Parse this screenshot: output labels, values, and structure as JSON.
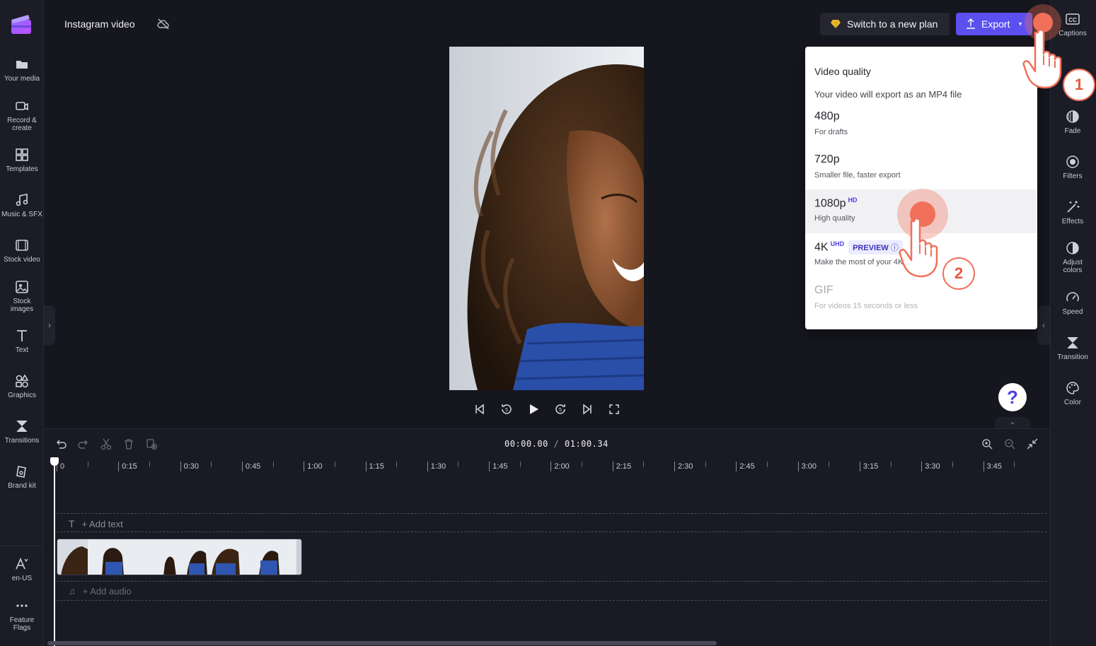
{
  "project": {
    "title": "Instagram video"
  },
  "left_sidebar": {
    "items": [
      {
        "label": "Your media",
        "icon": "folder-icon"
      },
      {
        "label": "Record & create",
        "icon": "camera-icon"
      },
      {
        "label": "Templates",
        "icon": "templates-icon"
      },
      {
        "label": "Music & SFX",
        "icon": "music-icon"
      },
      {
        "label": "Stock video",
        "icon": "film-icon"
      },
      {
        "label": "Stock images",
        "icon": "image-icon"
      },
      {
        "label": "Text",
        "icon": "text-icon"
      },
      {
        "label": "Graphics",
        "icon": "shapes-icon"
      },
      {
        "label": "Transitions",
        "icon": "transition-icon"
      },
      {
        "label": "Brand kit",
        "icon": "brand-kit-icon"
      }
    ],
    "bottom": [
      {
        "label": "en-US",
        "icon": "language-icon"
      },
      {
        "label": "Feature Flags",
        "icon": "more-icon"
      }
    ]
  },
  "header": {
    "switch_plan_label": "Switch to a new plan",
    "export_label": "Export"
  },
  "right_sidebar": {
    "items": [
      {
        "label": "Captions",
        "icon": "captions-icon"
      },
      {
        "label": "Fade",
        "icon": "fade-icon"
      },
      {
        "label": "Filters",
        "icon": "filters-icon"
      },
      {
        "label": "Effects",
        "icon": "effects-icon"
      },
      {
        "label": "Adjust colors",
        "icon": "adjust-icon"
      },
      {
        "label": "Speed",
        "icon": "speed-icon"
      },
      {
        "label": "Transition",
        "icon": "transition-icon"
      },
      {
        "label": "Color",
        "icon": "palette-icon"
      }
    ]
  },
  "export_menu": {
    "title": "Video quality",
    "subtitle": "Your video will export as an MP4 file",
    "options": [
      {
        "label": "480p",
        "badge": "",
        "tag": "",
        "desc": "For drafts"
      },
      {
        "label": "720p",
        "badge": "",
        "tag": "",
        "desc": "Smaller file, faster export"
      },
      {
        "label": "1080p",
        "badge": "HD",
        "tag": "",
        "desc": "High quality"
      },
      {
        "label": "4K",
        "badge": "UHD",
        "tag": "PREVIEW",
        "desc": "Make the most of your 4K"
      },
      {
        "label": "GIF",
        "badge": "",
        "tag": "",
        "desc": "For videos 15 seconds or less"
      }
    ]
  },
  "timeline": {
    "current_time": "00:00.00",
    "separator": "/",
    "total_time": "01:00.34",
    "ruler": [
      "0",
      "0:15",
      "0:30",
      "0:45",
      "1:00",
      "1:15",
      "1:30",
      "1:45",
      "2:00",
      "2:15",
      "2:30",
      "2:45",
      "3:00",
      "3:15",
      "3:30",
      "3:45"
    ],
    "add_text": "+ Add text",
    "add_audio": "+ Add audio"
  },
  "help": {
    "label": "?"
  },
  "steps": {
    "step1": "1",
    "step2": "2"
  },
  "colors": {
    "accent": "#5b4ff0",
    "tap": "#f0705a",
    "background": "#16161f"
  }
}
